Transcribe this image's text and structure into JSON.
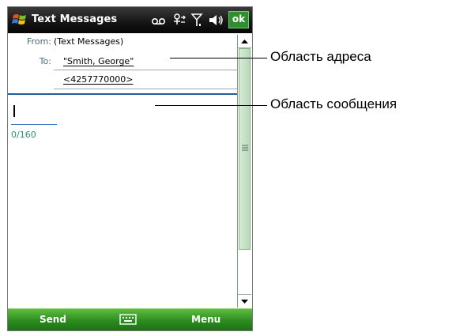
{
  "window": {
    "title": "Text Messages",
    "ok_label": "ok",
    "status_icons": [
      "voicemail-icon",
      "wifi-icon",
      "signal-icon",
      "volume-icon"
    ]
  },
  "header": {
    "from_label": "From:",
    "from_value": "(Text Messages)",
    "to_label": "To:",
    "to_name": "\"Smith, George\"",
    "to_number": "<4257770000>"
  },
  "message": {
    "text": "",
    "char_counter": "0/160"
  },
  "menu_bar": {
    "left_softkey": "Send",
    "center_icon": "keyboard-icon",
    "right_softkey": "Menu"
  },
  "callouts": {
    "address_area": "Область адреса",
    "message_area": "Область сообщения"
  },
  "colors": {
    "title_bar": "#141414",
    "ok_button": "#2f8f2f",
    "menu_bar": "#2a8a1f",
    "divider": "#1f5f9f",
    "counter_text": "#2f8f6f"
  }
}
